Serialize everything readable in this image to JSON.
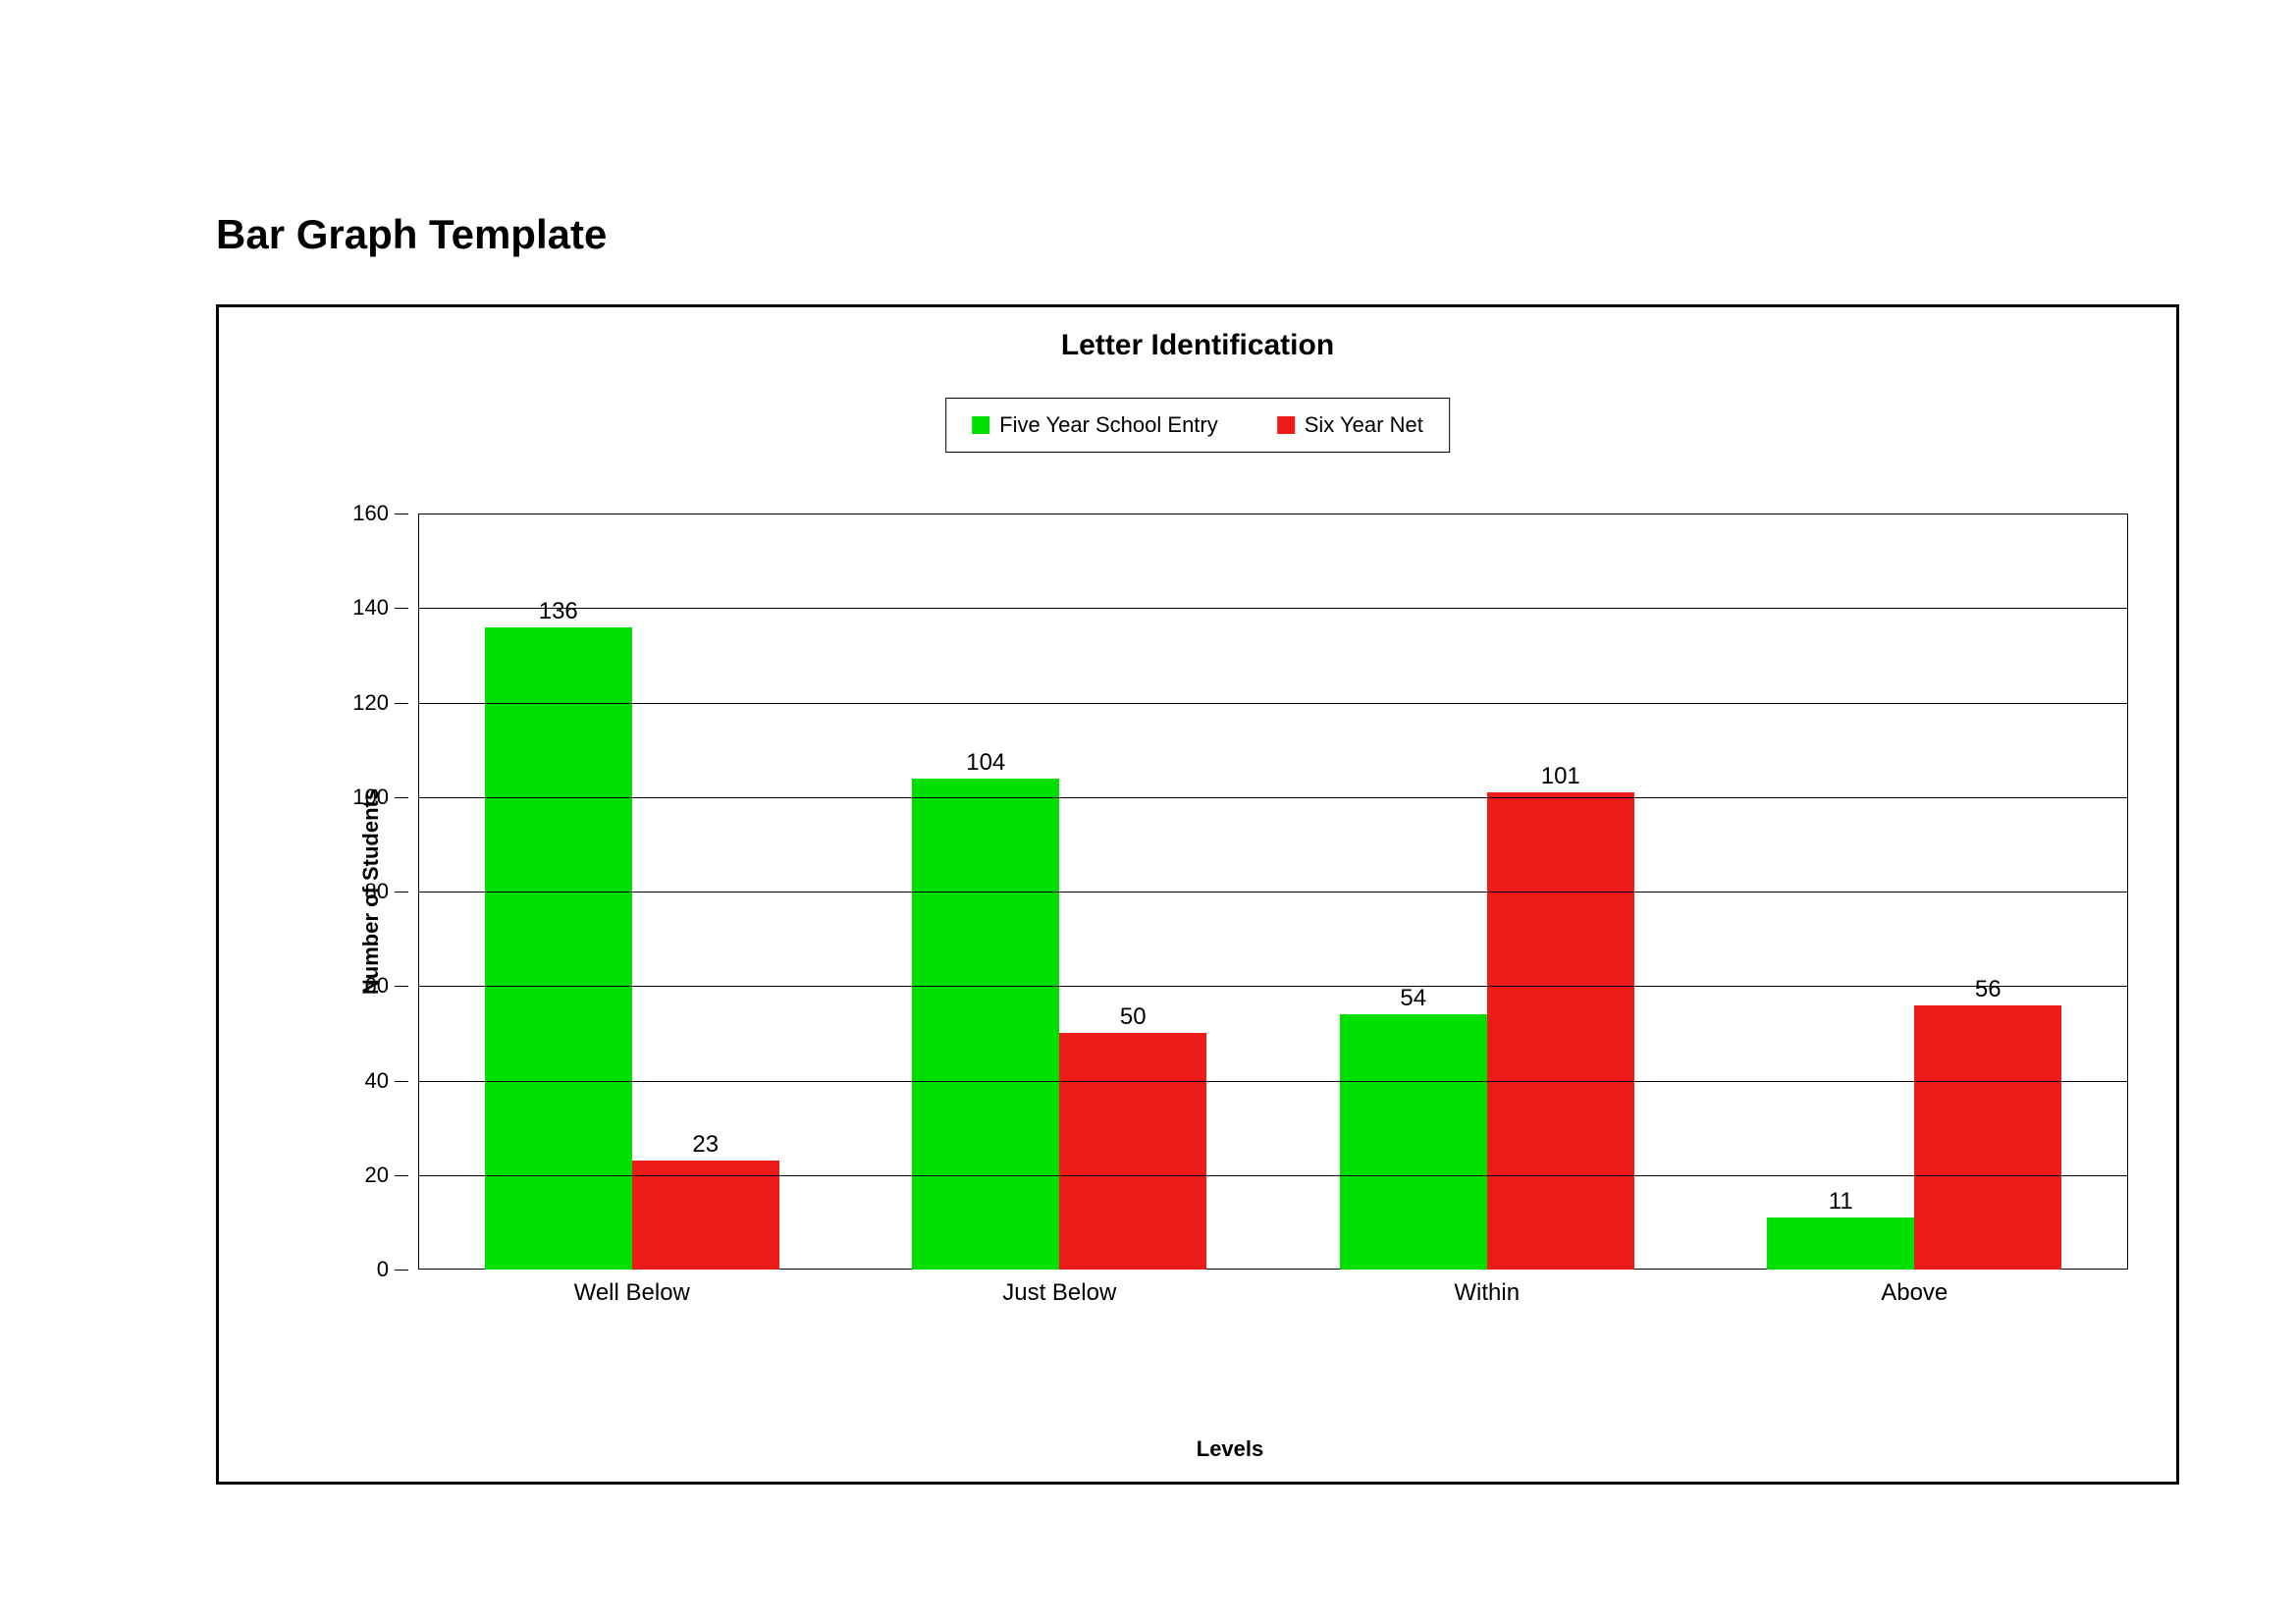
{
  "page_title": "Bar Graph Template",
  "chart_data": {
    "type": "bar",
    "title": "Letter Identification",
    "xlabel": "Levels",
    "ylabel": "Number of Students",
    "ylim": [
      0,
      160
    ],
    "ytick_step": 20,
    "categories": [
      "Well Below",
      "Just Below",
      "Within",
      "Above"
    ],
    "series": [
      {
        "name": "Five Year School Entry",
        "color": "#00e000",
        "values": [
          136,
          104,
          54,
          11
        ]
      },
      {
        "name": "Six Year Net",
        "color": "#ed1c19",
        "values": [
          23,
          50,
          101,
          56
        ]
      }
    ],
    "legend_position": "top",
    "grid": true
  }
}
